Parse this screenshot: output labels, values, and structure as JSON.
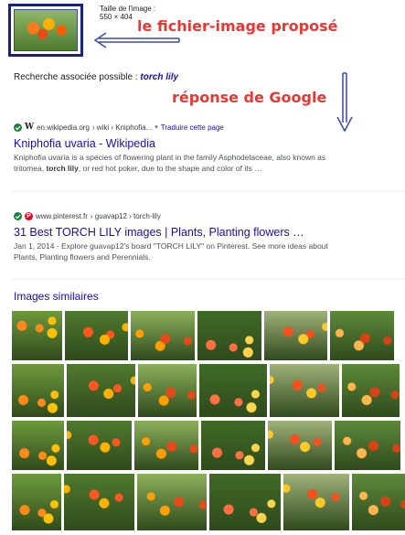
{
  "query": {
    "size_label_line1": "Taille de l'image :",
    "size_label_line2": "550 × 404"
  },
  "annotations": {
    "proposed_file": "le fichier-image proposé",
    "google_answer": "réponse de Google"
  },
  "related_search": {
    "prefix": "Recherche associée possible : ",
    "term": "torch lily"
  },
  "results": [
    {
      "favicon": "W",
      "site": "en.wikipedia.org",
      "path": "› wiki › Kniphofia...",
      "translate": "Traduire cette page",
      "title": "Kniphofia uvaria - Wikipedia",
      "snippet_a": "Kniphofia uvaria is a species of flowering plant in the family Asphodelaceae, also known as",
      "snippet_b1": "tritomea, ",
      "snippet_b2": "torch lily",
      "snippet_b3": ", or red hot poker, due to the shape and color of its …"
    },
    {
      "favicon": "P",
      "site": "www.pinterest.fr",
      "path": "› guavap12 › torch-lily",
      "title": "31 Best TORCH LILY images | Plants, Planting flowers …",
      "snippet_a": "Jan 1, 2014 - Explore guavap12's board \"TORCH LILY\" on Pinterest. See more ideas about",
      "snippet_b": "Plants, Planting flowers and Perennials."
    }
  ],
  "similar_images_heading": "Images similaires",
  "colors": {
    "link": "#1a0dab",
    "annotation": "#e53935",
    "border_dark": "#1a237e",
    "check_green": "#188038",
    "pinterest_red": "#e60023"
  },
  "icons": [
    "check-icon",
    "wikipedia-favicon-icon",
    "pinterest-favicon-icon",
    "chevron-down-icon",
    "arrow-left-icon",
    "arrow-down-icon"
  ]
}
